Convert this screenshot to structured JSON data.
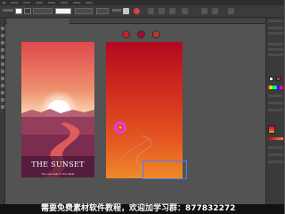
{
  "app": {
    "colors": {
      "workspace": "#535353",
      "panel": "#3a3a3a",
      "selection_blue": "#4e7ef5",
      "cursor_magenta": "#e23fd5",
      "sunset_red": "#b2091e",
      "sunset_orange": "#ef8a2a"
    }
  },
  "menubar": {
    "items": [
      "Ai",
      "",
      "",
      "",
      "",
      "",
      "",
      ""
    ]
  },
  "control_bar": {
    "stroke_value": "",
    "zoom": ""
  },
  "doc_tab": {
    "label": ""
  },
  "artboard1": {
    "title": "THE SUNSET",
    "subtitle": "The sun sets in the West"
  },
  "gradient_stops": [
    "#c0272d",
    "#a40b2c",
    "#b83a2c"
  ],
  "banner": {
    "text": "需要免费素材软件教程，欢迎加学习群：877832272"
  }
}
